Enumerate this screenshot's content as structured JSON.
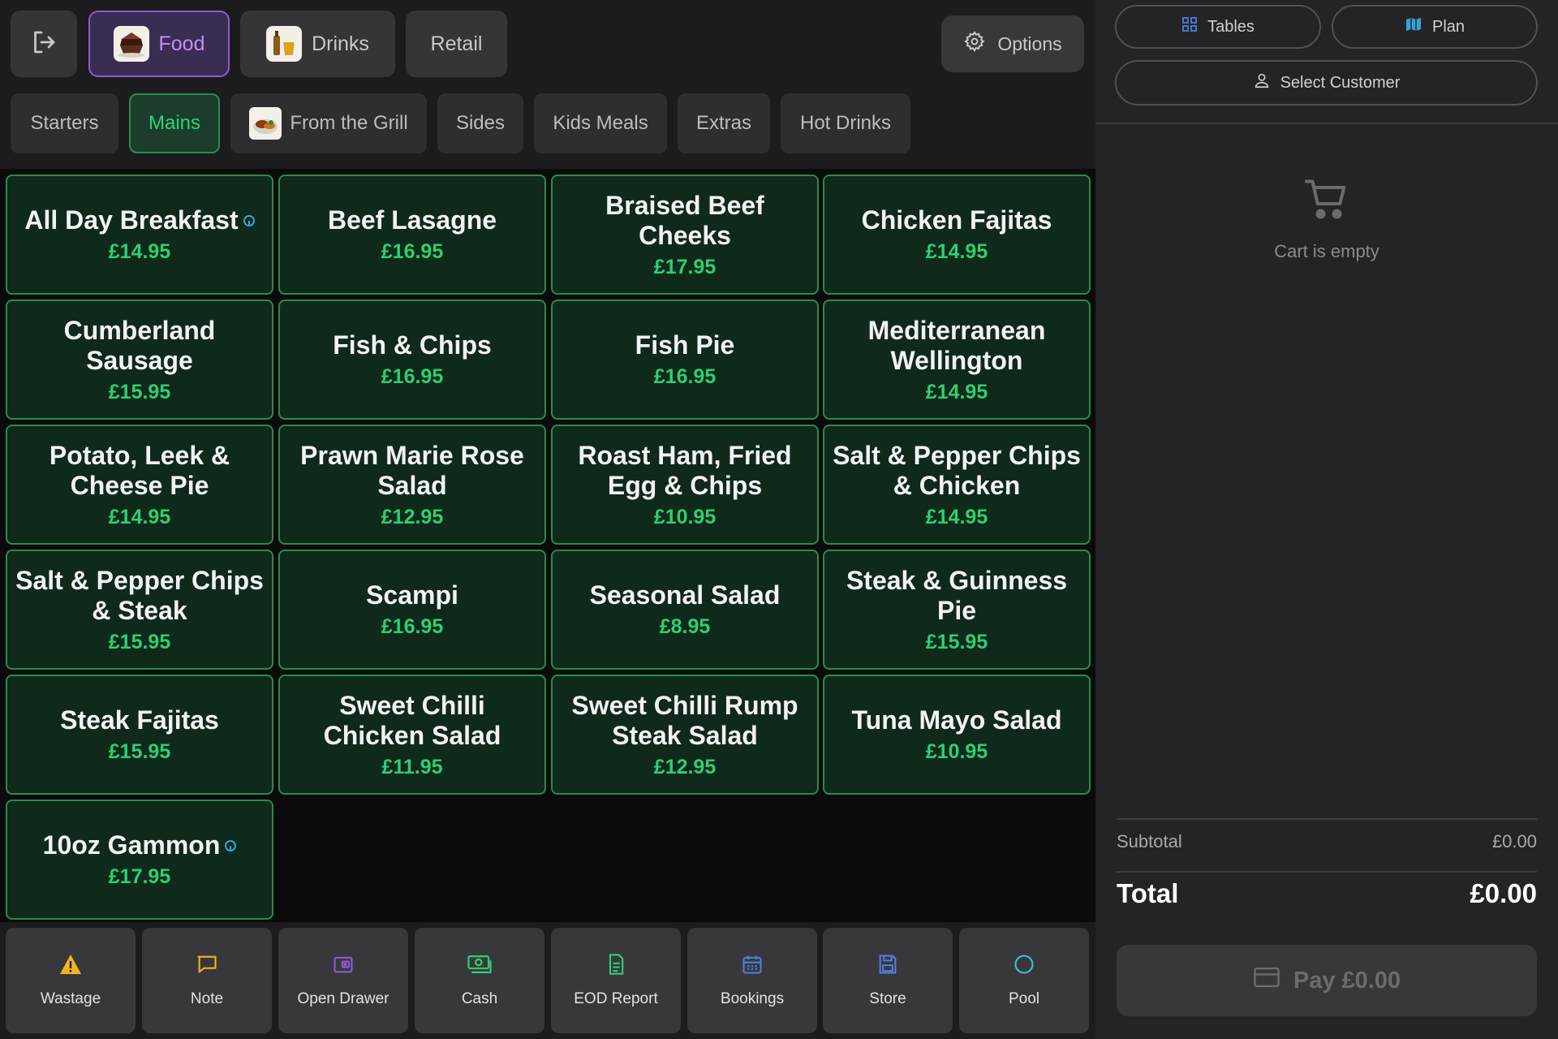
{
  "header": {
    "categories": [
      {
        "label": "Food",
        "icon": "food-thumbnail"
      },
      {
        "label": "Drinks",
        "icon": "drinks-thumbnail"
      },
      {
        "label": "Retail"
      }
    ],
    "options_label": "Options"
  },
  "subcategories": [
    {
      "label": "Starters"
    },
    {
      "label": "Mains"
    },
    {
      "label": "From the Grill",
      "icon": "grill-thumbnail"
    },
    {
      "label": "Sides"
    },
    {
      "label": "Kids Meals"
    },
    {
      "label": "Extras"
    },
    {
      "label": "Hot Drinks"
    }
  ],
  "items": [
    {
      "name": "All Day Breakfast",
      "price": "£14.95",
      "info": true
    },
    {
      "name": "Beef Lasagne",
      "price": "£16.95"
    },
    {
      "name": "Braised Beef Cheeks",
      "price": "£17.95"
    },
    {
      "name": "Chicken Fajitas",
      "price": "£14.95"
    },
    {
      "name": "Cumberland Sausage",
      "price": "£15.95"
    },
    {
      "name": "Fish & Chips",
      "price": "£16.95"
    },
    {
      "name": "Fish Pie",
      "price": "£16.95"
    },
    {
      "name": "Mediterranean Wellington",
      "price": "£14.95"
    },
    {
      "name": "Potato, Leek & Cheese Pie",
      "price": "£14.95"
    },
    {
      "name": "Prawn Marie Rose Salad",
      "price": "£12.95"
    },
    {
      "name": "Roast Ham, Fried Egg & Chips",
      "price": "£10.95"
    },
    {
      "name": "Salt & Pepper Chips & Chicken",
      "price": "£14.95"
    },
    {
      "name": "Salt & Pepper Chips & Steak",
      "price": "£15.95"
    },
    {
      "name": "Scampi",
      "price": "£16.95"
    },
    {
      "name": "Seasonal Salad",
      "price": "£8.95"
    },
    {
      "name": "Steak & Guinness Pie",
      "price": "£15.95"
    },
    {
      "name": "Steak Fajitas",
      "price": "£15.95"
    },
    {
      "name": "Sweet Chilli Chicken Salad",
      "price": "£11.95"
    },
    {
      "name": "Sweet Chilli Rump Steak Salad",
      "price": "£12.95"
    },
    {
      "name": "Tuna Mayo Salad",
      "price": "£10.95"
    },
    {
      "name": "10oz Gammon",
      "price": "£17.95",
      "info": true
    }
  ],
  "actions": [
    {
      "label": "Wastage",
      "icon": "warning-icon",
      "color": "#f2b51c"
    },
    {
      "label": "Note",
      "icon": "note-icon",
      "color": "#f2b51c"
    },
    {
      "label": "Open Drawer",
      "icon": "wallet-icon",
      "color": "#8e5ad6"
    },
    {
      "label": "Cash",
      "icon": "cash-icon",
      "color": "#2fce72"
    },
    {
      "label": "EOD Report",
      "icon": "report-icon",
      "color": "#2fce72"
    },
    {
      "label": "Bookings",
      "icon": "calendar-icon",
      "color": "#4f7ee0"
    },
    {
      "label": "Store",
      "icon": "save-icon",
      "color": "#4f7ee0"
    },
    {
      "label": "Pool",
      "icon": "circle-icon",
      "color": "#35c4d6"
    }
  ],
  "cart": {
    "tables_label": "Tables",
    "plan_label": "Plan",
    "select_customer_label": "Select Customer",
    "empty_text": "Cart is empty",
    "subtotal_label": "Subtotal",
    "subtotal_value": "£0.00",
    "total_label": "Total",
    "total_value": "£0.00",
    "pay_label": "Pay £0.00"
  },
  "colors": {
    "accent_food": "#c48cff",
    "accent_mains": "#32d07a",
    "price_green": "#2fce72",
    "item_bg": "#0f2a1b",
    "item_border": "#2a8a4e"
  }
}
